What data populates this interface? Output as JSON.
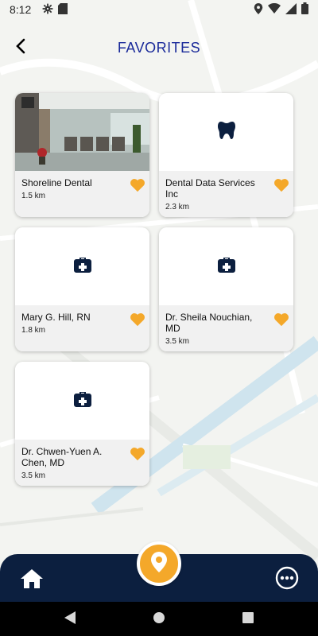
{
  "status_bar": {
    "time": "8:12",
    "icons_left": [
      "gear-icon",
      "sd-card-icon"
    ],
    "icons_right": [
      "location-icon",
      "wifi-icon",
      "signal-icon",
      "battery-icon"
    ]
  },
  "header": {
    "title": "FAVORITES",
    "back_icon": "chevron-left-icon"
  },
  "favorites": [
    {
      "name": "Shoreline Dental",
      "distance": "1.5 km",
      "media": "photo",
      "favorited": true
    },
    {
      "name": "Dental Data Services Inc",
      "distance": "2.3 km",
      "media": "tooth-icon",
      "favorited": true
    },
    {
      "name": "Mary G. Hill, RN",
      "distance": "1.8 km",
      "media": "medical-kit-icon",
      "favorited": true
    },
    {
      "name": "Dr. Sheila Nouchian, MD",
      "distance": "3.5 km",
      "media": "medical-kit-icon",
      "favorited": true
    },
    {
      "name": "Dr. Chwen-Yuen A. Chen, MD",
      "distance": "3.5 km",
      "media": "medical-kit-icon",
      "favorited": true
    }
  ],
  "bottom_nav": {
    "left_icon": "home-icon",
    "center_icon": "map-pin-icon",
    "right_icon": "more-icon"
  },
  "system_nav": [
    "back-icon",
    "home-icon",
    "recents-icon"
  ],
  "colors": {
    "title": "#1a2a9a",
    "navy": "#0c1f3f",
    "accent": "#f4a82a",
    "card_footer": "#f1f1f1"
  }
}
